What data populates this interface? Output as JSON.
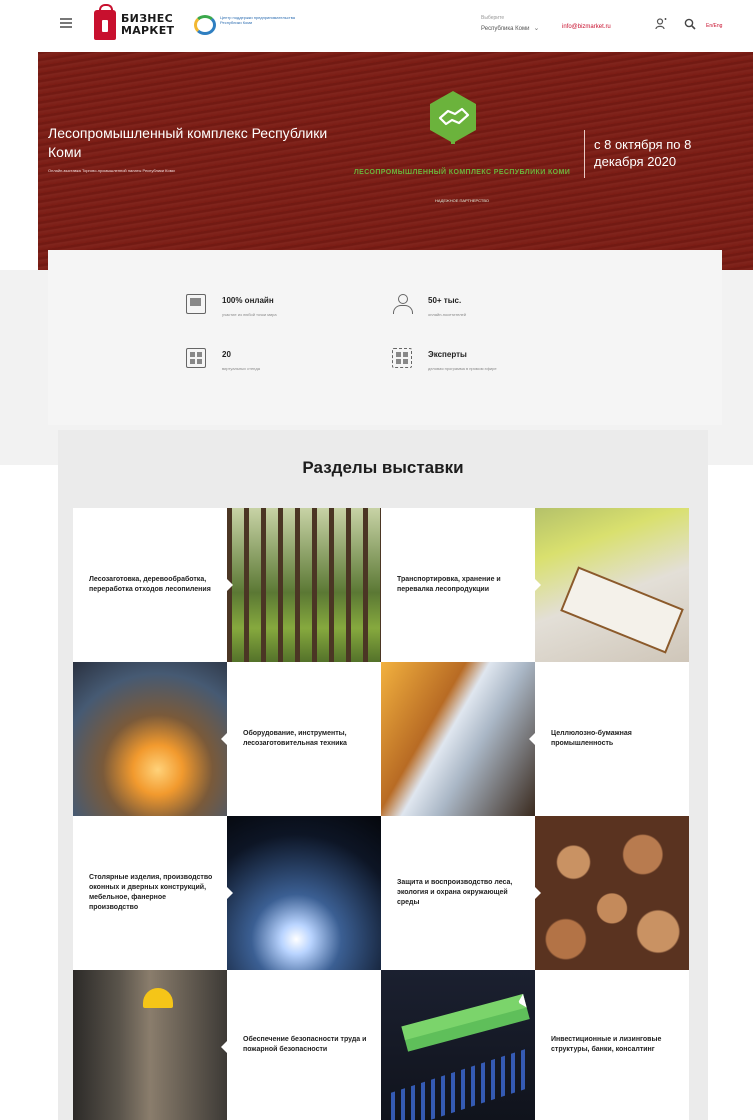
{
  "header": {
    "logo_text_line1": "БИЗНЕС",
    "logo_text_line2": "МАРКЕТ",
    "partner_logo_text": "Центр поддержки предпринимательства Республики Коми",
    "region_label": "Выберите",
    "region_value": "Республика Коми",
    "email": "info@bizmarket.ru",
    "lang": "En/Eng"
  },
  "hero": {
    "title": "Лесопромышленный комплекс Республики Коми",
    "subtitle": "Онлайн-выставка Торгово-промышленной палаты Республики Коми",
    "expo_name": "ЛЕСОПРОМЫШЛЕННЫЙ КОМПЛЕКС РЕСПУБЛИКИ КОМИ",
    "expo_tagline": "НАДЕЖНОЕ ПАРТНЕРСТВО",
    "dates": "с 8 октября по 8 декабря 2020",
    "brand_green": "#6bb33c",
    "wood_color": "#7b1c14"
  },
  "stats": [
    {
      "icon": "screen-icon",
      "title": "100% онлайн",
      "desc": "участие из любой точки мира"
    },
    {
      "icon": "people-icon",
      "title": "50+ тыс.",
      "desc": "онлайн-посетителей"
    },
    {
      "icon": "grid-icon",
      "title": "20",
      "desc": "виртуальных стенда"
    },
    {
      "icon": "experts-icon",
      "title": "Эксперты",
      "desc": "деловая программа в прямом эфире"
    }
  ],
  "sections": {
    "title": "Разделы выставки",
    "items": [
      "Лесозаготовка, деревообработка, переработка отходов лесопиления",
      "Транспортировка, хранение и перевалка лесопродукции",
      "Оборудование, инструменты, лесозаготовительная техника",
      "Целлюлозно-бумажная промышленность",
      "Столярные изделия, производство оконных и дверных конструкций, мебельное, фанерное производство",
      "Защита и воспроизводство леса, экология и охрана окружающей среды",
      "Обеспечение безопасности труда и пожарной безопасности",
      "Инвестиционные и лизинговые структуры, банки, консалтинг"
    ]
  }
}
